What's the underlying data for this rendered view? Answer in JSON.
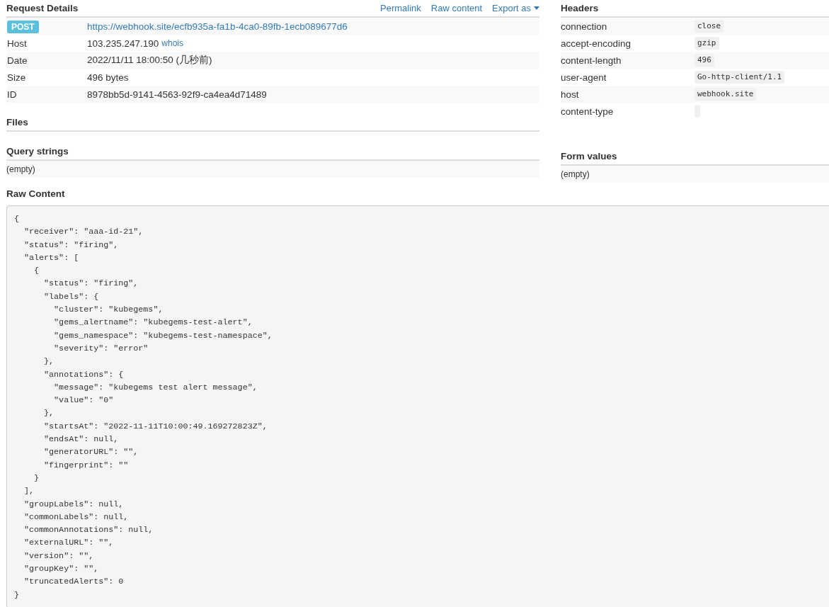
{
  "request_details": {
    "title": "Request Details",
    "actions": [
      {
        "label": "Permalink",
        "kind": "link"
      },
      {
        "label": "Raw content",
        "kind": "link"
      },
      {
        "label": "Export as",
        "kind": "dropdown"
      }
    ],
    "method": "POST",
    "url": "https://webhook.site/ecfb935a-fa1b-4ca0-89fb-1ecb089677d6",
    "rows": [
      {
        "label": "Host",
        "value": "103.235.247.190",
        "link": "whois"
      },
      {
        "label": "Date",
        "value": "2022/11/11 18:00:50 (几秒前)"
      },
      {
        "label": "Size",
        "value": "496 bytes"
      },
      {
        "label": "ID",
        "value": "8978bb5d-9141-4563-92f9-ca4ea4d71489"
      }
    ]
  },
  "files": {
    "title": "Files"
  },
  "query_strings": {
    "title": "Query strings",
    "value": "(empty)"
  },
  "headers": {
    "title": "Headers",
    "rows": [
      {
        "name": "connection",
        "value": "close"
      },
      {
        "name": "accept-encoding",
        "value": "gzip"
      },
      {
        "name": "content-length",
        "value": "496"
      },
      {
        "name": "user-agent",
        "value": "Go-http-client/1.1"
      },
      {
        "name": "host",
        "value": "webhook.site"
      },
      {
        "name": "content-type"
      }
    ]
  },
  "form_values": {
    "title": "Form values",
    "value": "(empty)"
  },
  "raw_content": {
    "title": "Raw Content",
    "text": "{\n  \"receiver\": \"aaa-id-21\",\n  \"status\": \"firing\",\n  \"alerts\": [\n    {\n      \"status\": \"firing\",\n      \"labels\": {\n        \"cluster\": \"kubegems\",\n        \"gems_alertname\": \"kubegems-test-alert\",\n        \"gems_namespace\": \"kubegems-test-namespace\",\n        \"severity\": \"error\"\n      },\n      \"annotations\": {\n        \"message\": \"kubegems test alert message\",\n        \"value\": \"0\"\n      },\n      \"startsAt\": \"2022-11-11T10:00:49.169272823Z\",\n      \"endsAt\": null,\n      \"generatorURL\": \"\",\n      \"fingerprint\": \"\"\n    }\n  ],\n  \"groupLabels\": null,\n  \"commonLabels\": null,\n  \"commonAnnotations\": null,\n  \"externalURL\": \"\",\n  \"version\": \"\",\n  \"groupKey\": \"\",\n  \"truncatedAlerts\": 0\n}"
  }
}
